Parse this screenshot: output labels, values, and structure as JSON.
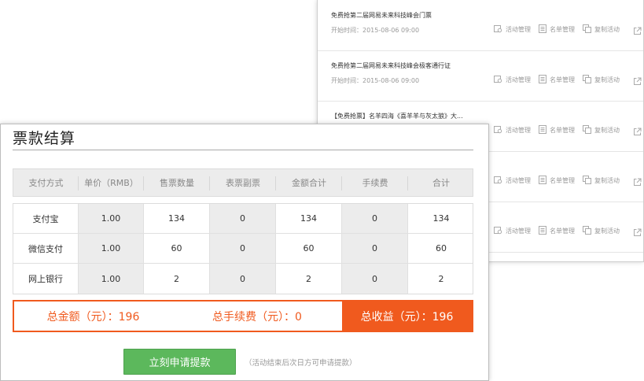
{
  "event_list": {
    "items": [
      {
        "title": "免费抢第二届网易未来科技峰会门票",
        "time": "开始时间：2015-08-06 09:00"
      },
      {
        "title": "免费抢第二届网易未来科技峰会极客通行证",
        "time": "开始时间：2015-08-06 09:00"
      },
      {
        "title": "【免费抢票】名羊四海《喜羊羊与灰太狼》大...",
        "time": ""
      },
      {
        "title": "",
        "time": ""
      },
      {
        "title": "",
        "time": ""
      }
    ],
    "actions": {
      "activity_manage": "活动管理",
      "list_manage": "名单管理",
      "copy_activity": "复制活动"
    }
  },
  "settlement": {
    "title": "票款结算",
    "columns": [
      "支付方式",
      "单价（RMB）",
      "售票数量",
      "表票副票",
      "金额合计",
      "手续费",
      "合计"
    ],
    "rows": [
      [
        "支付宝",
        "1.00",
        "134",
        "0",
        "134",
        "0",
        "134"
      ],
      [
        "微信支付",
        "1.00",
        "60",
        "0",
        "60",
        "0",
        "60"
      ],
      [
        "网上银行",
        "1.00",
        "2",
        "0",
        "2",
        "0",
        "2"
      ]
    ],
    "totals": {
      "total_amount": "总金额（元）：196",
      "total_fee": "总手续费（元）：0",
      "total_income": "总收益（元）：196"
    },
    "apply_button": "立刻申请提款",
    "apply_note": "（活动结束后次日方可申请提款）"
  },
  "colors": {
    "accent_orange": "#f05a1e",
    "button_green": "#5cb85c",
    "header_gray": "#ececec"
  }
}
